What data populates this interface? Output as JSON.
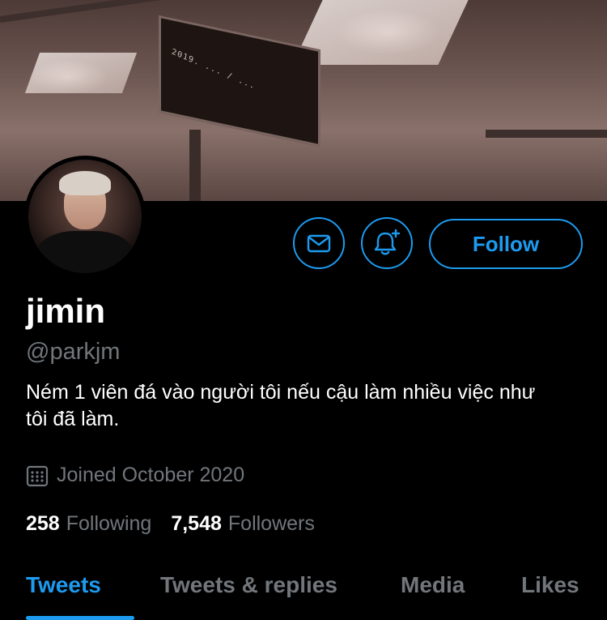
{
  "banner": {
    "sign_text": "2019. ... / ..."
  },
  "profile": {
    "name": "jimin",
    "handle": "@parkjm",
    "bio": "Ném 1 viên đá vào người tôi nếu cậu làm nhiều việc như tôi đã làm.",
    "joined": "Joined October 2020"
  },
  "actions": {
    "message_icon": "mail-icon",
    "notify_icon": "bell-plus-icon",
    "follow_label": "Follow"
  },
  "stats": {
    "following_count": "258",
    "following_label": "Following",
    "followers_count": "7,548",
    "followers_label": "Followers"
  },
  "tabs": [
    {
      "label": "Tweets",
      "active": true
    },
    {
      "label": "Tweets & replies",
      "active": false
    },
    {
      "label": "Media",
      "active": false
    },
    {
      "label": "Likes",
      "active": false
    }
  ],
  "colors": {
    "accent": "#1d9bf0",
    "muted": "#71767b",
    "background": "#000000"
  }
}
